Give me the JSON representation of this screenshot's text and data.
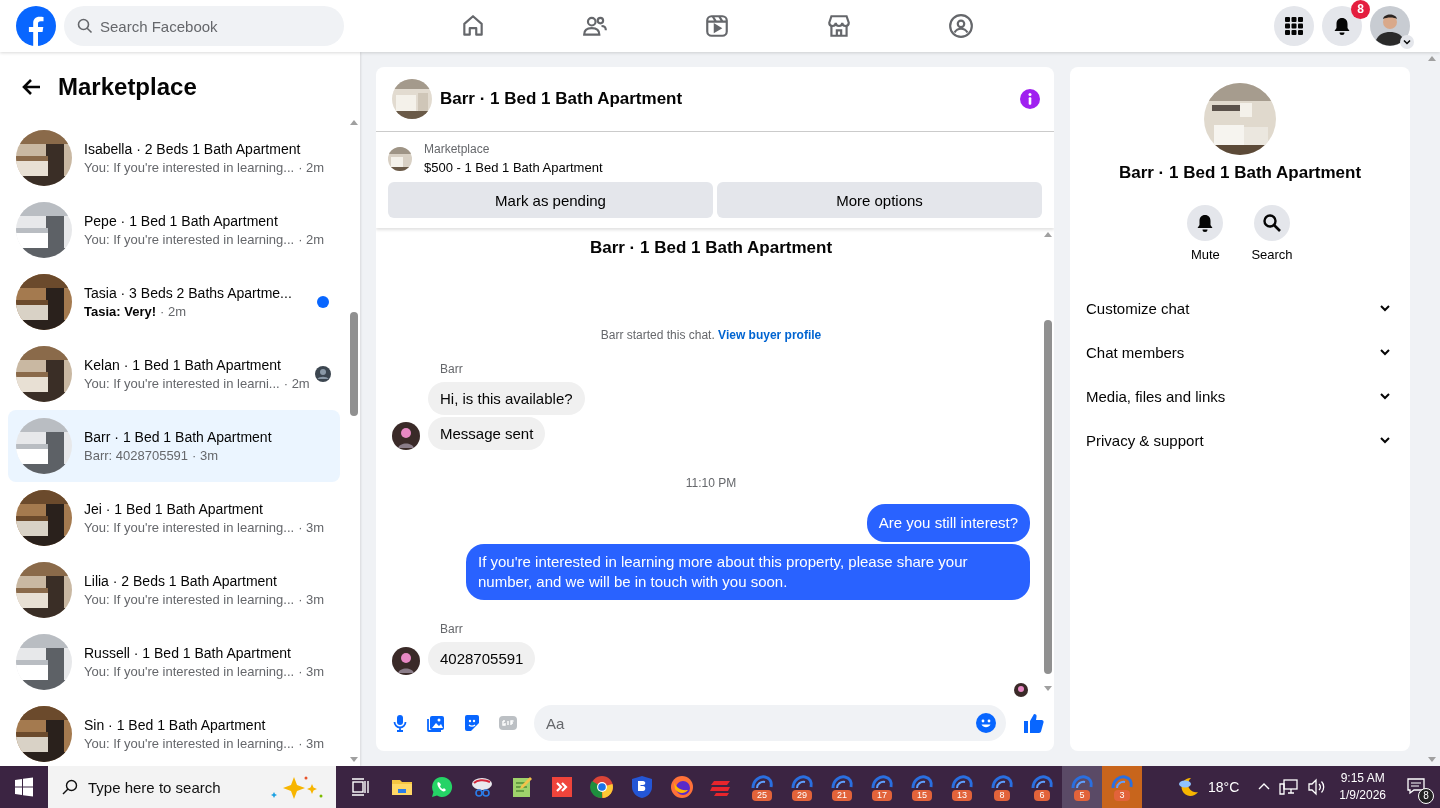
{
  "topbar": {
    "search": {
      "placeholder": "Search Facebook"
    },
    "notifications_badge": "8"
  },
  "sidebar": {
    "title": "Marketplace",
    "chats": [
      {
        "name": "Isabella · 2 Beds 1 Bath Apartment",
        "preview": "You: If you're interested in learning...",
        "time": "· 2m",
        "selected": false,
        "unread": false,
        "seen": false
      },
      {
        "name": "Pepe · 1 Bed 1 Bath Apartment",
        "preview": "You: If you're interested in learning...",
        "time": "· 2m",
        "selected": false,
        "unread": false,
        "seen": false
      },
      {
        "name": "Tasia · 3 Beds 2 Baths Apartme...",
        "preview": "Tasia: Very!",
        "time": "· 2m",
        "selected": false,
        "unread": true,
        "seen": false
      },
      {
        "name": "Kelan · 1 Bed 1 Bath Apartment",
        "preview": "You: If you're interested in learni...",
        "time": "· 2m",
        "selected": false,
        "unread": false,
        "seen": true
      },
      {
        "name": "Barr · 1 Bed 1 Bath Apartment",
        "preview": "Barr: 4028705591",
        "time": "· 3m",
        "selected": true,
        "unread": false,
        "seen": false
      },
      {
        "name": "Jei · 1 Bed 1 Bath Apartment",
        "preview": "You: If you're interested in learning...",
        "time": "· 3m",
        "selected": false,
        "unread": false,
        "seen": false
      },
      {
        "name": "Lilia · 2 Beds 1 Bath Apartment",
        "preview": "You: If you're interested in learning...",
        "time": "· 3m",
        "selected": false,
        "unread": false,
        "seen": false
      },
      {
        "name": "Russell · 1 Bed 1 Bath Apartment",
        "preview": "You: If you're interested in learning...",
        "time": "· 3m",
        "selected": false,
        "unread": false,
        "seen": false
      },
      {
        "name": "Sin · 1 Bed 1 Bath Apartment",
        "preview": "You: If you're interested in learning...",
        "time": "· 3m",
        "selected": false,
        "unread": false,
        "seen": false
      }
    ]
  },
  "chat": {
    "title": "Barr · 1 Bed 1 Bath Apartment",
    "listing": {
      "source": "Marketplace",
      "summary": "$500 - 1 Bed 1 Bath Apartment"
    },
    "buttons": [
      "Mark as pending",
      "More options"
    ],
    "messages": [
      {
        "kind": "intro",
        "text": "Barr · 1 Bed 1 Bath Apartment"
      },
      {
        "kind": "system",
        "text": "Barr started this chat.",
        "link": "View buyer profile"
      },
      {
        "kind": "sender",
        "text": "Barr"
      },
      {
        "kind": "incoming",
        "text": "Hi, is this available?",
        "avatar": false
      },
      {
        "kind": "incoming",
        "text": "Message sent",
        "avatar": true
      },
      {
        "kind": "time",
        "text": "11:10 PM"
      },
      {
        "kind": "outgoing",
        "text": "Are you still interest?"
      },
      {
        "kind": "outgoing",
        "text": "If you're interested in learning more about this property, please share your number, and we will be in touch with you soon."
      },
      {
        "kind": "sender",
        "text": "Barr"
      },
      {
        "kind": "incoming",
        "text": "4028705591",
        "avatar": true
      },
      {
        "kind": "receipt"
      }
    ],
    "composer": {
      "placeholder": "Aa"
    }
  },
  "details": {
    "title": "Barr · 1 Bed 1 Bath Apartment",
    "actions": [
      "Mute",
      "Search"
    ],
    "sections": [
      "Customize chat",
      "Chat members",
      "Media, files and links",
      "Privacy & support"
    ]
  },
  "taskbar": {
    "search_placeholder": "Type here to search",
    "badges": [
      "25",
      "29",
      "21",
      "17",
      "15",
      "13",
      "8",
      "6",
      "5",
      "3"
    ],
    "temperature": "18°C",
    "time": "9:15 AM",
    "date": "1/9/2026",
    "notifications": "8"
  }
}
